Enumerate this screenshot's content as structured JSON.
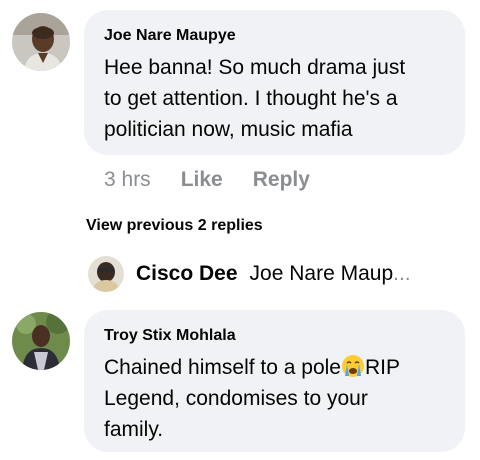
{
  "comments": [
    {
      "author": "Joe Nare Maupye",
      "line1": "Hee banna! So much drama just",
      "line2": "to get attention. I thought he's a",
      "line3": "politician now, music mafia",
      "time": "3 hrs",
      "like_label": "Like",
      "reply_label": "Reply"
    },
    {
      "author": "Troy Stix Mohlala",
      "line1_before_emoji": "Chained himself to a pole",
      "emoji_name": "crying-face-emoji",
      "line1_after_emoji": "RIP",
      "line2": "Legend, condomises to your",
      "line3": "family."
    }
  ],
  "view_previous": "View previous 2 replies",
  "reply_preview": {
    "name": "Cisco Dee",
    "snippet": "Joe Nare Maup",
    "ellipsis": "..."
  },
  "colors": {
    "bubble": "#f0f2f5",
    "text": "#050505",
    "muted": "#8a8d91"
  }
}
